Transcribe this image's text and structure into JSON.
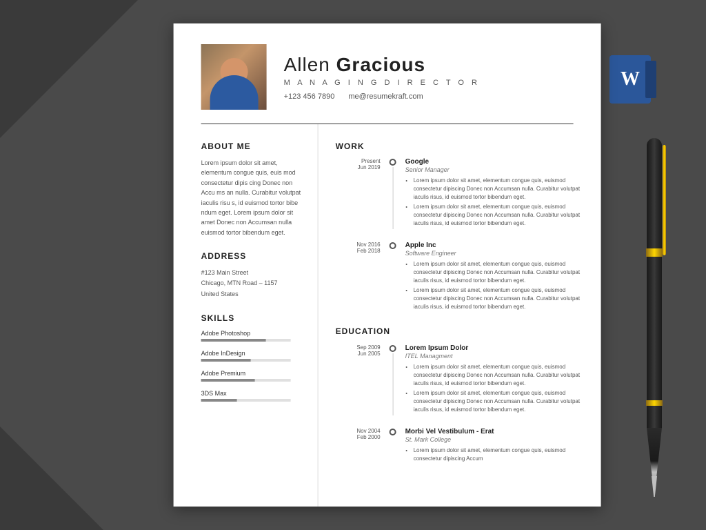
{
  "background": {
    "color": "#4a4a4a"
  },
  "word_icon": {
    "label": "W"
  },
  "header": {
    "name_first": "Allen",
    "name_last": "Gracious",
    "title": "M A N A G I N G   D I R E C T O R",
    "phone": "+123 456 7890",
    "email": "me@resumekraft.com"
  },
  "about": {
    "section_title": "ABOUT ME",
    "text": "Lorem ipsum dolor sit amet, elementum congue quis, euis mod  consectetur dipis cing Donec non Accu ms an nulla. Curabitur volutpat iaculis risu s, id euismod tortor bibe ndum eget. Lorem ipsum dolor sit amet Donec non Accumsan nulla euismod tortor bibendum eget."
  },
  "address": {
    "section_title": "ADDRESS",
    "line1": "#123 Main Street",
    "line2": "Chicago, MTN Road – 1157",
    "line3": "United States"
  },
  "skills": {
    "section_title": "SKILLS",
    "items": [
      {
        "name": "Adobe Photoshop",
        "percent": 72
      },
      {
        "name": "Adobe InDesign",
        "percent": 55
      },
      {
        "name": "Adobe Premium",
        "percent": 60
      },
      {
        "name": "3DS Max",
        "percent": 40
      }
    ]
  },
  "work": {
    "section_title": "WORK",
    "items": [
      {
        "date_top": "Present",
        "date_bottom": "Jun 2019",
        "company": "Google",
        "job_title": "Senior Manager",
        "bullets": [
          "Lorem ipsum dolor sit amet, elementum congue quis, euismod  consectetur dipiscing Donec non Accumsan nulla. Curabitur volutpat iaculis risus, id euismod tortor bibendum eget.",
          "Lorem ipsum dolor sit amet, elementum congue quis, euismod  consectetur dipiscing Donec non Accumsan nulla. Curabitur volutpat iaculis risus, id euismod tortor bibendum eget."
        ]
      },
      {
        "date_top": "Nov 2016",
        "date_bottom": "Feb 2018",
        "company": "Apple Inc",
        "job_title": "Software Engineer",
        "bullets": [
          "Lorem ipsum dolor sit amet, elementum congue quis, euismod  consectetur dipiscing Donec non Accumsan nulla. Curabitur volutpat iaculis risus, id euismod tortor bibendum eget.",
          "Lorem ipsum dolor sit amet, elementum congue quis, euismod  consectetur dipiscing Donec non Accumsan nulla. Curabitur volutpat iaculis risus, id euismod tortor bibendum eget."
        ]
      }
    ]
  },
  "education": {
    "section_title": "EDUCATION",
    "items": [
      {
        "date_top": "Sep 2009",
        "date_bottom": "Jun 2005",
        "institution": "Lorem Ipsum Dolor",
        "degree": "ITEL Managment",
        "bullets": [
          "Lorem ipsum dolor sit amet, elementum congue quis, euismod  consectetur dipiscing Donec non Accumsan nulla. Curabitur volutpat iaculis risus, id euismod tortor bibendum eget.",
          "Lorem ipsum dolor sit amet, elementum congue quis, euismod  consectetur dipiscing Donec non Accumsan nulla. Curabitur volutpat iaculis risus, id euismod tortor bibendum eget."
        ]
      },
      {
        "date_top": "Nov 2004",
        "date_bottom": "Feb 2000",
        "institution": "Morbi Vel Vestibulum - Erat",
        "degree": "St. Mark College",
        "bullets": [
          "Lorem ipsum dolor sit amet, elementum congue quis, euismod  consectetur dipiscing Accum"
        ]
      }
    ]
  }
}
